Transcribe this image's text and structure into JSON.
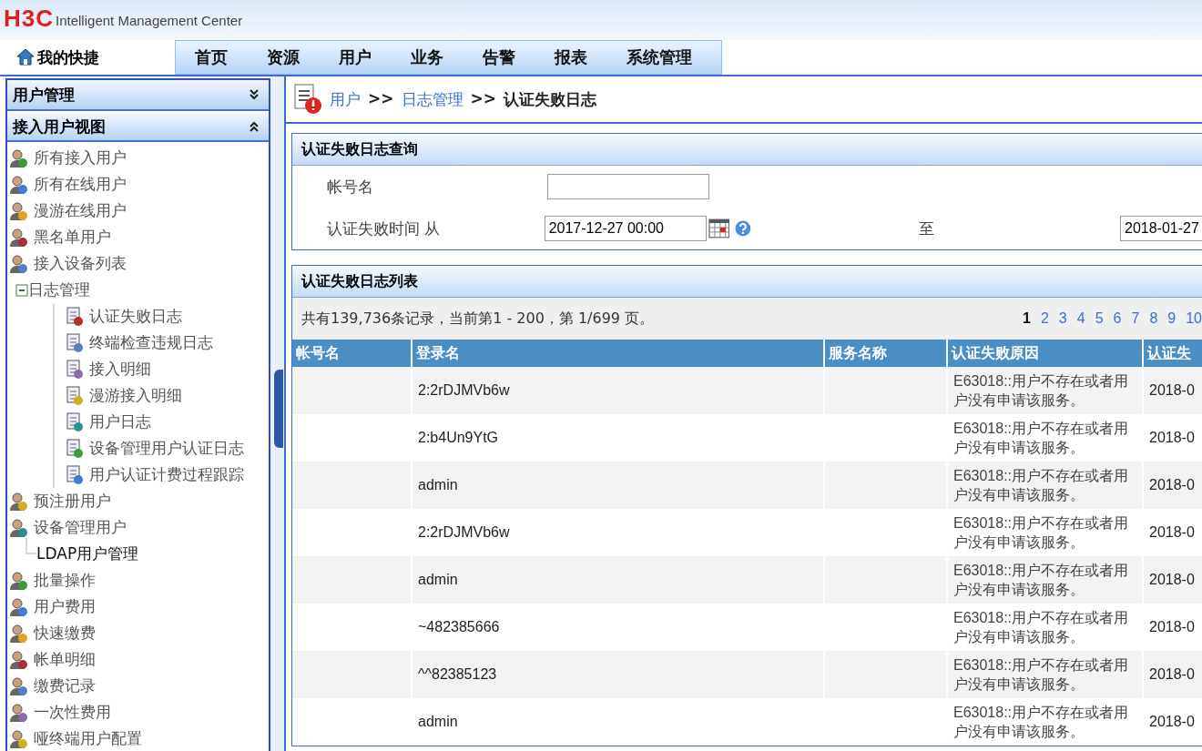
{
  "header": {
    "logo": "H3C",
    "product": "Intelligent Management Center"
  },
  "nav": {
    "shortcut": "我的快捷",
    "tabs": [
      {
        "label": "首页",
        "selected": false
      },
      {
        "label": "资源",
        "selected": false
      },
      {
        "label": "用户",
        "selected": false
      },
      {
        "label": "业务",
        "selected": false
      },
      {
        "label": "告警",
        "selected": false
      },
      {
        "label": "报表",
        "selected": false
      },
      {
        "label": "系统管理",
        "selected": false
      }
    ]
  },
  "sidebar": {
    "sections": [
      {
        "title": "用户管理",
        "expanded": false
      },
      {
        "title": "接入用户视图",
        "expanded": true
      }
    ],
    "items": [
      {
        "label": "所有接入用户"
      },
      {
        "label": "所有在线用户"
      },
      {
        "label": "漫游在线用户"
      },
      {
        "label": "黑名单用户"
      },
      {
        "label": "接入设备列表"
      },
      {
        "label": "日志管理",
        "expanded": true,
        "children": [
          {
            "label": "认证失败日志"
          },
          {
            "label": "终端检查违规日志"
          },
          {
            "label": "接入明细"
          },
          {
            "label": "漫游接入明细"
          },
          {
            "label": "用户日志"
          },
          {
            "label": "设备管理用户认证日志"
          },
          {
            "label": "用户认证计费过程跟踪"
          }
        ]
      },
      {
        "label": "预注册用户"
      },
      {
        "label": "设备管理用户",
        "children": [
          {
            "label": "LDAP用户管理"
          }
        ]
      },
      {
        "label": "批量操作"
      },
      {
        "label": "用户费用"
      },
      {
        "label": "快速缴费"
      },
      {
        "label": "帐单明细"
      },
      {
        "label": "缴费记录"
      },
      {
        "label": "一次性费用"
      },
      {
        "label": "哑终端用户配置"
      }
    ]
  },
  "breadcrumb": [
    {
      "label": "用户",
      "link": true
    },
    {
      "label": ">>",
      "link": false
    },
    {
      "label": "日志管理",
      "link": true
    },
    {
      "label": ">>",
      "link": false
    },
    {
      "label": "认证失败日志",
      "link": false
    }
  ],
  "query": {
    "title": "认证失败日志查询",
    "account_label": "帐号名",
    "time_label": "认证失败时间 从",
    "from": "2017-12-27 00:00",
    "to_label": "至",
    "to": "2018-01-27"
  },
  "list": {
    "title": "认证失败日志列表",
    "summary": "共有139,736条记录，当前第1 - 200，第 1/699 页。",
    "pages": [
      {
        "label": "1",
        "selected": true
      },
      {
        "label": "2",
        "selected": false
      },
      {
        "label": "3",
        "selected": false
      },
      {
        "label": "4",
        "selected": false
      },
      {
        "label": "5",
        "selected": false
      },
      {
        "label": "6",
        "selected": false
      },
      {
        "label": "7",
        "selected": false
      },
      {
        "label": "8",
        "selected": false
      },
      {
        "label": "9",
        "selected": false
      },
      {
        "label": "10",
        "selected": false
      }
    ],
    "columns": [
      {
        "label": "帐号名",
        "sortable": false
      },
      {
        "label": "登录名",
        "sortable": false
      },
      {
        "label": "服务名称",
        "sortable": false
      },
      {
        "label": "认证失败原因",
        "sortable": false
      },
      {
        "label": "认证失",
        "sortable": true
      }
    ],
    "rows": [
      {
        "login": "2:2rDJMVb6w",
        "reason": "E63018::用户不存在或者用户没有申请该服务。",
        "time": "2018-0"
      },
      {
        "login": "2:b4Un9YtG",
        "reason": "E63018::用户不存在或者用户没有申请该服务。",
        "time": "2018-0"
      },
      {
        "login": "admin",
        "reason": "E63018::用户不存在或者用户没有申请该服务。",
        "time": "2018-0"
      },
      {
        "login": "2:2rDJMVb6w",
        "reason": "E63018::用户不存在或者用户没有申请该服务。",
        "time": "2018-0"
      },
      {
        "login": "admin",
        "reason": "E63018::用户不存在或者用户没有申请该服务。",
        "time": "2018-0"
      },
      {
        "login": "~482385666",
        "reason": "E63018::用户不存在或者用户没有申请该服务。",
        "time": "2018-0"
      },
      {
        "login": "^^82385123",
        "reason": "E63018::用户不存在或者用户没有申请该服务。",
        "time": "2018-0"
      },
      {
        "login": "admin",
        "reason": "E63018::用户不存在或者用户没有申请该服务。",
        "time": "2018-0"
      }
    ]
  }
}
